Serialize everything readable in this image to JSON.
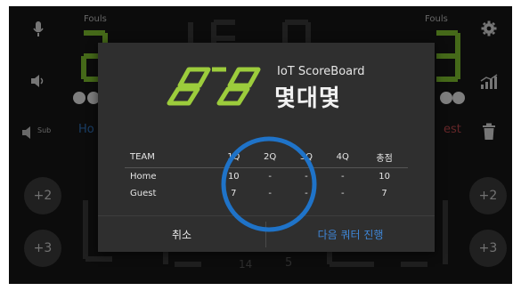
{
  "scoreboard": {
    "fouls_left_label": "Fouls",
    "fouls_right_label": "Fouls",
    "home_team_partial": "Ho",
    "guest_team_partial": "est",
    "sub_label": "Sub",
    "plus2_left": "+2",
    "plus3_left": "+3",
    "plus2_right": "+2",
    "plus3_right": "+3",
    "shot_clock_small": "14",
    "small_number_bottom": "5",
    "colors": {
      "accent_green": "#7fbf2e",
      "home_blue": "#4a8fd8",
      "guest_red": "#e0565a",
      "circle_blue": "#1f73c8"
    },
    "icons": [
      "microphone-icon",
      "speaker-icon",
      "gear-icon",
      "stats-icon",
      "trash-icon",
      "mute-icon"
    ]
  },
  "dialog": {
    "brand_title": "IoT ScoreBoard",
    "brand_name": "몇대몇",
    "table": {
      "headers": [
        "TEAM",
        "1Q",
        "2Q",
        "3Q",
        "4Q",
        "총점"
      ],
      "rows": [
        {
          "team": "Home",
          "cells": [
            "10",
            "-",
            "-",
            "-",
            "10"
          ]
        },
        {
          "team": "Guest",
          "cells": [
            "7",
            "-",
            "-",
            "-",
            "7"
          ]
        }
      ]
    },
    "cancel_label": "취소",
    "next_label": "다음 쿼터 진행"
  }
}
